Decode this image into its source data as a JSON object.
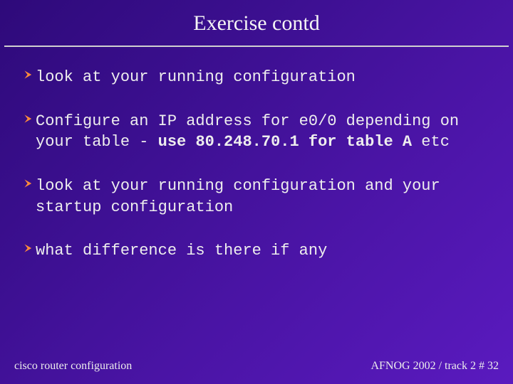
{
  "title": "Exercise contd",
  "bullets": {
    "b1": "look at your running configuration",
    "b2_pre": "Configure an IP address for e0/0 depending on your table - ",
    "b2_bold": "use 80.248.70.1 for table A",
    "b2_post": " etc",
    "b3": "look at your running configuration and your startup configuration",
    "b4": "what difference is there if any"
  },
  "footer": {
    "left": "cisco router configuration",
    "right": "AFNOG 2002 / track 2  # 32"
  }
}
